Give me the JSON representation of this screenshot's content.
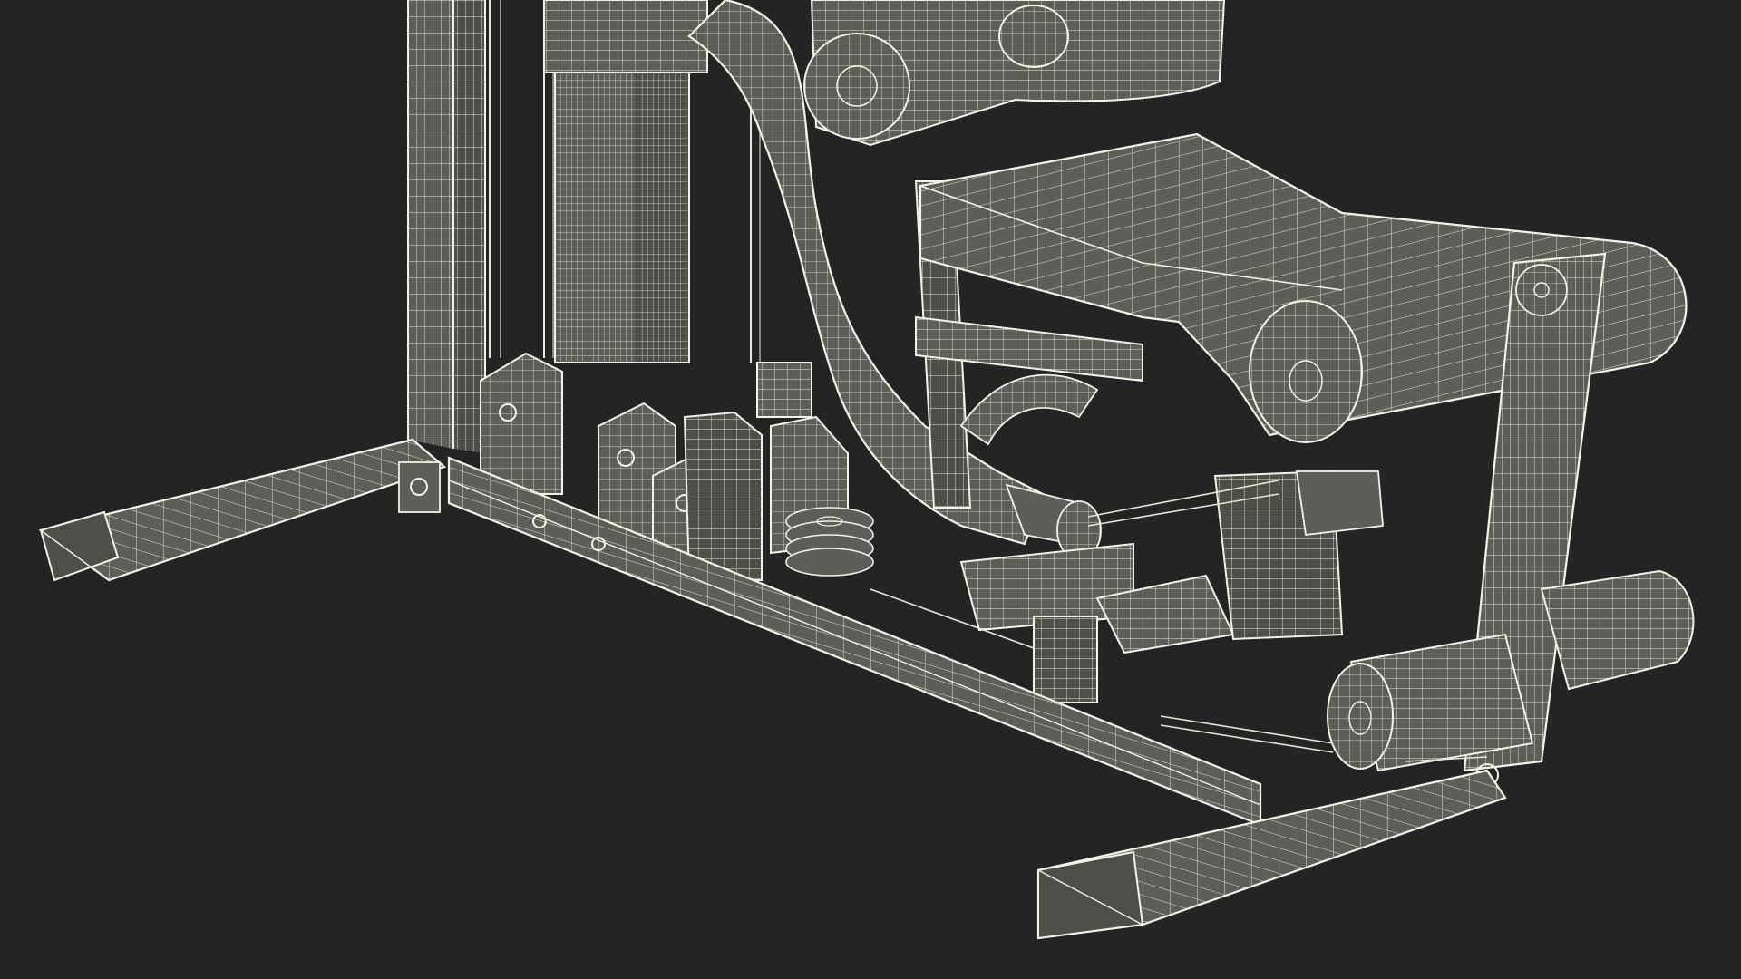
{
  "scene": {
    "background_color": "#242424",
    "model_fill_color": "#5e5e58",
    "model_shade_color": "#4f4f4a",
    "wire_color": "#e8e6d8",
    "edge_color": "#f4f2e6"
  }
}
